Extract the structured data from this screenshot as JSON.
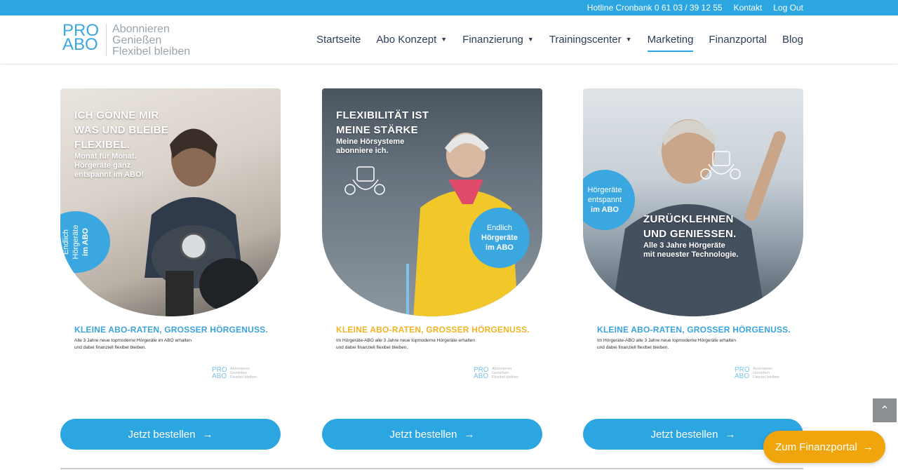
{
  "topbar": {
    "hotline": "Hotline Cronbank 0 61 03 / 39 12 55",
    "contact": "Kontakt",
    "logout": "Log Out"
  },
  "logo": {
    "mark_line1": "PRO",
    "mark_line2": "ABO",
    "tagline": [
      "Abonnieren",
      "Genießen",
      "Flexibel bleiben"
    ]
  },
  "nav": {
    "items": [
      {
        "label": "Startseite",
        "dropdown": false,
        "active": false
      },
      {
        "label": "Abo Konzept",
        "dropdown": true,
        "active": false
      },
      {
        "label": "Finanzierung",
        "dropdown": true,
        "active": false
      },
      {
        "label": "Trainingscenter",
        "dropdown": true,
        "active": false
      },
      {
        "label": "Marketing",
        "dropdown": false,
        "active": true
      },
      {
        "label": "Finanzportal",
        "dropdown": false,
        "active": false
      },
      {
        "label": "Blog",
        "dropdown": false,
        "active": false
      }
    ]
  },
  "cards": [
    {
      "headline": [
        "ICH GÖNNE MIR",
        "WAS UND BLEIBE",
        "FLEXIBEL."
      ],
      "subline": [
        "Monat für Monat.",
        "Hörgeräte ganz",
        "entspannt im ABO!"
      ],
      "badge": [
        "Endlich",
        "Hörgeräte",
        "im ABO"
      ],
      "slogan": "KLEINE ABO-RATEN, GROSSER HÖRGENUSS.",
      "copy": [
        "Alle 3 Jahre neue topmoderne Hörgeräte im ABO erhalten",
        "und dabei finanziell flexibel bleiben."
      ],
      "button": "Jetzt bestellen"
    },
    {
      "headline": [
        "FLEXIBILITÄT IST",
        "MEINE STÄRKE"
      ],
      "subline": [
        "Meine Hörsysteme",
        "abonniere ich."
      ],
      "badge": [
        "Endlich",
        "Hörgeräte",
        "im ABO"
      ],
      "slogan": "KLEINE ABO-RATEN, GROSSER HÖRGENUSS.",
      "copy": [
        "Im Hörgeräte-ABO alle 3 Jahre neue topmoderne Hörgeräte erhalten",
        "und dabei finanziell flexibel bleiben."
      ],
      "button": "Jetzt bestellen"
    },
    {
      "headline": [
        "ZURÜCKLEHNEN",
        "UND GENIESSEN."
      ],
      "subline": [
        "Alle 3 Jahre Hörgeräte",
        "mit neuester Technologie."
      ],
      "badge": [
        "Hörgeräte",
        "entspannt",
        "im ABO"
      ],
      "slogan": "KLEINE ABO-RATEN, GROSSER HÖRGENUSS.",
      "copy": [
        "Im Hörgeräte-ABO alle 3 Jahre neue topmoderne Hörgeräte erhalten",
        "und dabei finanziell flexibel bleiben."
      ],
      "button": "Jetzt bestellen"
    }
  ],
  "mini_logo": {
    "mark_line1": "PRO",
    "mark_line2": "ABO",
    "tagline": [
      "Abonnieren",
      "Genießen",
      "Flexibel bleiben"
    ]
  },
  "portal_button": "Zum Finanzportal",
  "icons": {
    "arrow": "arrow-right-icon",
    "chevron": "chevron-down-icon",
    "scroll_top": "chevron-up-icon"
  },
  "colors": {
    "brand_blue": "#2ca6e0",
    "accent_orange": "#f0a50c",
    "slogan_blue": "#3aa3dc",
    "slogan_yellow": "#f0b323"
  }
}
